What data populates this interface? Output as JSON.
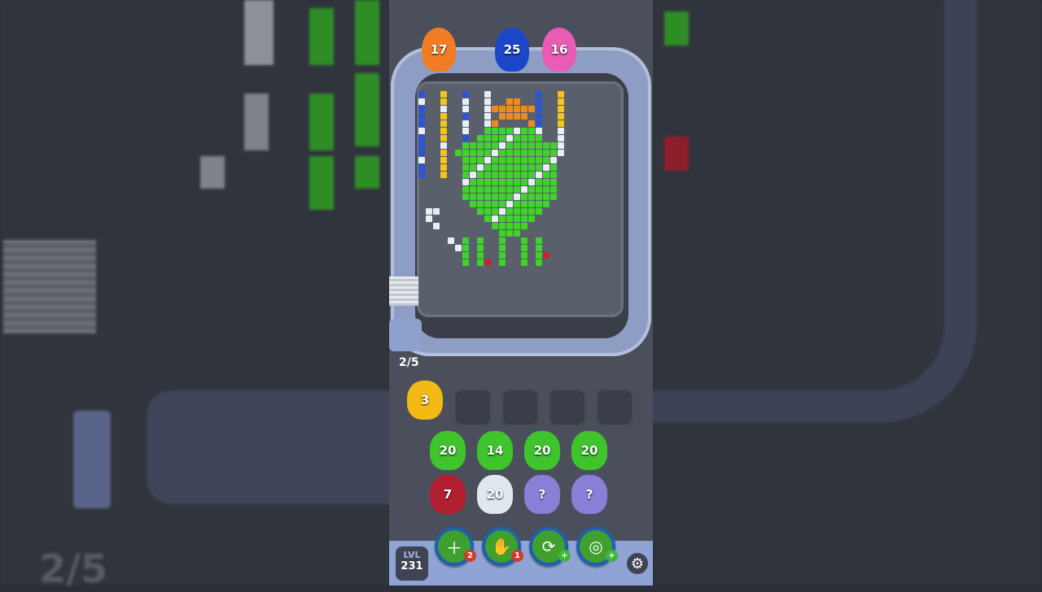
{
  "background": {
    "progress_ghost": "2/5"
  },
  "shooters_top": [
    {
      "count": "17",
      "color": "#f07d24"
    },
    {
      "count": "25",
      "color": "#1c46c8"
    },
    {
      "count": "16",
      "color": "#e85cb4"
    }
  ],
  "progress": "2/5",
  "queue_slots": [
    {
      "count": "3",
      "color": "#f3b915",
      "filled": true
    },
    {
      "filled": false
    },
    {
      "filled": false
    },
    {
      "filled": false
    },
    {
      "filled": false
    }
  ],
  "pots_row1": [
    {
      "count": "20",
      "color": "#3fc42c"
    },
    {
      "count": "14",
      "color": "#3fc42c"
    },
    {
      "count": "20",
      "color": "#3fc42c"
    },
    {
      "count": "20",
      "color": "#3fc42c"
    }
  ],
  "pots_row2": [
    {
      "count": "7",
      "color": "#b21f30"
    },
    {
      "count": "20",
      "color": "#dfe8ef"
    },
    {
      "count": "?",
      "color": "#8a7fd6"
    },
    {
      "count": "?",
      "color": "#8a7fd6"
    }
  ],
  "level": {
    "label": "LVL",
    "number": "231"
  },
  "boosters": [
    {
      "icon": "add-slot-icon",
      "badge": "2",
      "badge_color": "#d43a2a"
    },
    {
      "icon": "hand-pick-icon",
      "badge": "1",
      "badge_color": "#d43a2a"
    },
    {
      "icon": "shuffle-icon",
      "badge": "+",
      "badge_color": "#3fb83a"
    },
    {
      "icon": "magnet-cart-icon",
      "badge": "+",
      "badge_color": "#3fb83a"
    }
  ],
  "settings": {
    "icon": "gear-icon"
  },
  "colors": {
    "green": "#3fd42a",
    "orange": "#f08a1c",
    "yellow": "#f5c51a",
    "blue": "#2a55d6",
    "white": "#e9eef3",
    "red": "#c4213a"
  }
}
